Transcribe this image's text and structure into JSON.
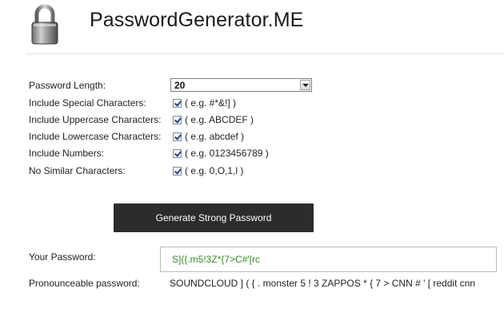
{
  "header": {
    "title": "PasswordGenerator.ME",
    "logo_icon": "padlock-icon"
  },
  "options": {
    "length_label": "Password Length:",
    "length_value": "20",
    "items": [
      {
        "label": "Include Special Characters:",
        "example": "( e.g. #*&!] )",
        "checked": true
      },
      {
        "label": "Include Uppercase Characters:",
        "example": "( e.g. ABCDEF )",
        "checked": true
      },
      {
        "label": "Include Lowercase Characters:",
        "example": "( e.g. abcdef )",
        "checked": true
      },
      {
        "label": "Include Numbers:",
        "example": "( e.g. 0123456789 )",
        "checked": true
      },
      {
        "label": "No Similar Characters:",
        "example": "( e.g. 0,O,1,l )",
        "checked": true
      }
    ]
  },
  "generate_button": {
    "label": "Generate Strong Password"
  },
  "result": {
    "password_label": "Your Password:",
    "password_value": "S]({.m5!3Z*{7>C#'[rc",
    "pronounceable_label": "Pronounceable password:",
    "pronounceable_value": "SOUNDCLOUD ] ( { . monster 5 ! 3 ZAPPOS * { 7 > CNN # ' [ reddit cnn"
  },
  "colors": {
    "button_bg": "#2c2c2c",
    "password_text": "#3a8a2a"
  }
}
